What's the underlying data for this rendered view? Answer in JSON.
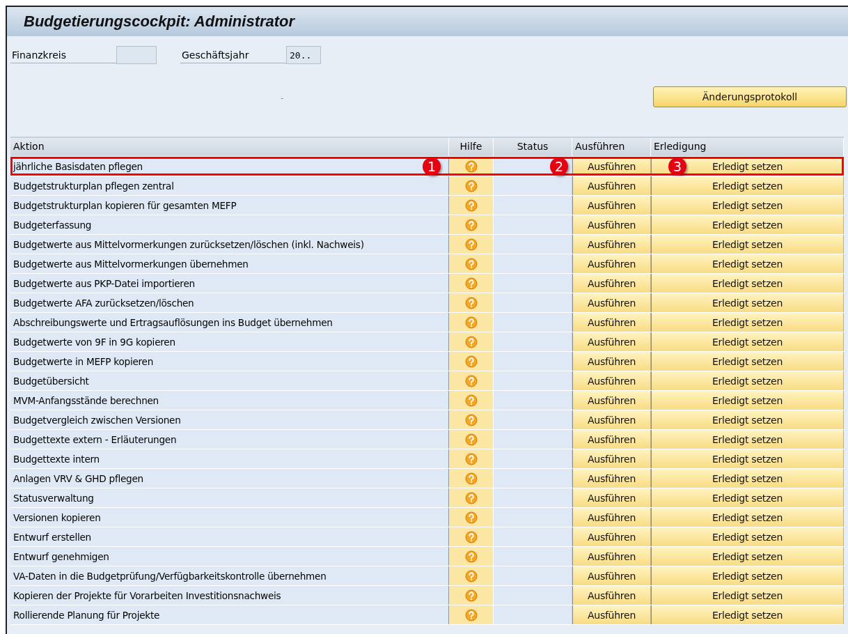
{
  "window": {
    "title": "Budgetierungscockpit: Administrator"
  },
  "fields": [
    {
      "label": "Finanzkreis"
    },
    {
      "label": "Geschäftsjahr",
      "value": "20.."
    }
  ],
  "mark": "¨",
  "toolbar": {
    "button": "Änderungsprotokoll"
  },
  "table": {
    "columns": [
      "Aktion",
      "Hilfe",
      "Status",
      "Ausführen",
      "Erledigung"
    ],
    "rows": [
      {
        "action": "jährliche Basisdaten pflegen",
        "run": "Ausführen",
        "done": "Erledigt setzen",
        "highlighted": true
      },
      {
        "action": "Budgetstrukturplan pflegen zentral",
        "run": "Ausführen",
        "done": "Erledigt setzen",
        "highlighted": false
      },
      {
        "action": "Budgetstrukturplan kopieren für gesamten MEFP",
        "run": "Ausführen",
        "done": "Erledigt setzen",
        "highlighted": false
      },
      {
        "action": "Budgeterfassung",
        "run": "Ausführen",
        "done": "Erledigt setzen",
        "highlighted": false
      },
      {
        "action": "Budgetwerte aus Mittelvormerkungen zurücksetzen/löschen (inkl. Nachweis)",
        "run": "Ausführen",
        "done": "Erledigt setzen",
        "highlighted": false
      },
      {
        "action": "Budgetwerte aus Mittelvormerkungen übernehmen",
        "run": "Ausführen",
        "done": "Erledigt setzen",
        "highlighted": false
      },
      {
        "action": "Budgetwerte aus PKP-Datei importieren",
        "run": "Ausführen",
        "done": "Erledigt setzen",
        "highlighted": false
      },
      {
        "action": "Budgetwerte AFA zurücksetzen/löschen",
        "run": "Ausführen",
        "done": "Erledigt setzen",
        "highlighted": false
      },
      {
        "action": "Abschreibungswerte und Ertragsauflösungen ins Budget übernehmen",
        "run": "Ausführen",
        "done": "Erledigt setzen",
        "highlighted": false
      },
      {
        "action": "Budgetwerte von 9F in 9G kopieren",
        "run": "Ausführen",
        "done": "Erledigt setzen",
        "highlighted": false
      },
      {
        "action": "Budgetwerte in MEFP kopieren",
        "run": "Ausführen",
        "done": "Erledigt setzen",
        "highlighted": false
      },
      {
        "action": "Budgetübersicht",
        "run": "Ausführen",
        "done": "Erledigt setzen",
        "highlighted": false
      },
      {
        "action": "MVM-Anfangsstände berechnen",
        "run": "Ausführen",
        "done": "Erledigt setzen",
        "highlighted": false
      },
      {
        "action": "Budgetvergleich zwischen Versionen",
        "run": "Ausführen",
        "done": "Erledigt setzen",
        "highlighted": false
      },
      {
        "action": "Budgettexte extern - Erläuterungen",
        "run": "Ausführen",
        "done": "Erledigt setzen",
        "highlighted": false
      },
      {
        "action": "Budgettexte intern",
        "run": "Ausführen",
        "done": "Erledigt setzen",
        "highlighted": false
      },
      {
        "action": "Anlagen VRV & GHD pflegen",
        "run": "Ausführen",
        "done": "Erledigt setzen",
        "highlighted": false
      },
      {
        "action": "Statusverwaltung",
        "run": "Ausführen",
        "done": "Erledigt setzen",
        "highlighted": false
      },
      {
        "action": "Versionen kopieren",
        "run": "Ausführen",
        "done": "Erledigt setzen",
        "highlighted": false
      },
      {
        "action": "Entwurf erstellen",
        "run": "Ausführen",
        "done": "Erledigt setzen",
        "highlighted": false
      },
      {
        "action": "Entwurf genehmigen",
        "run": "Ausführen",
        "done": "Erledigt setzen",
        "highlighted": false
      },
      {
        "action": "VA-Daten in die Budgetprüfung/Verfügbarkeitskontrolle übernehmen",
        "run": "Ausführen",
        "done": "Erledigt setzen",
        "highlighted": false
      },
      {
        "action": "Kopieren der Projekte für Vorarbeiten Investitionsnachweis",
        "run": "Ausführen",
        "done": "Erledigt setzen",
        "highlighted": false
      },
      {
        "action": "Rollierende Planung für Projekte",
        "run": "Ausführen",
        "done": "Erledigt setzen",
        "highlighted": false
      }
    ]
  },
  "annotations": [
    {
      "label": "1"
    },
    {
      "label": "2"
    },
    {
      "label": "3"
    }
  ]
}
